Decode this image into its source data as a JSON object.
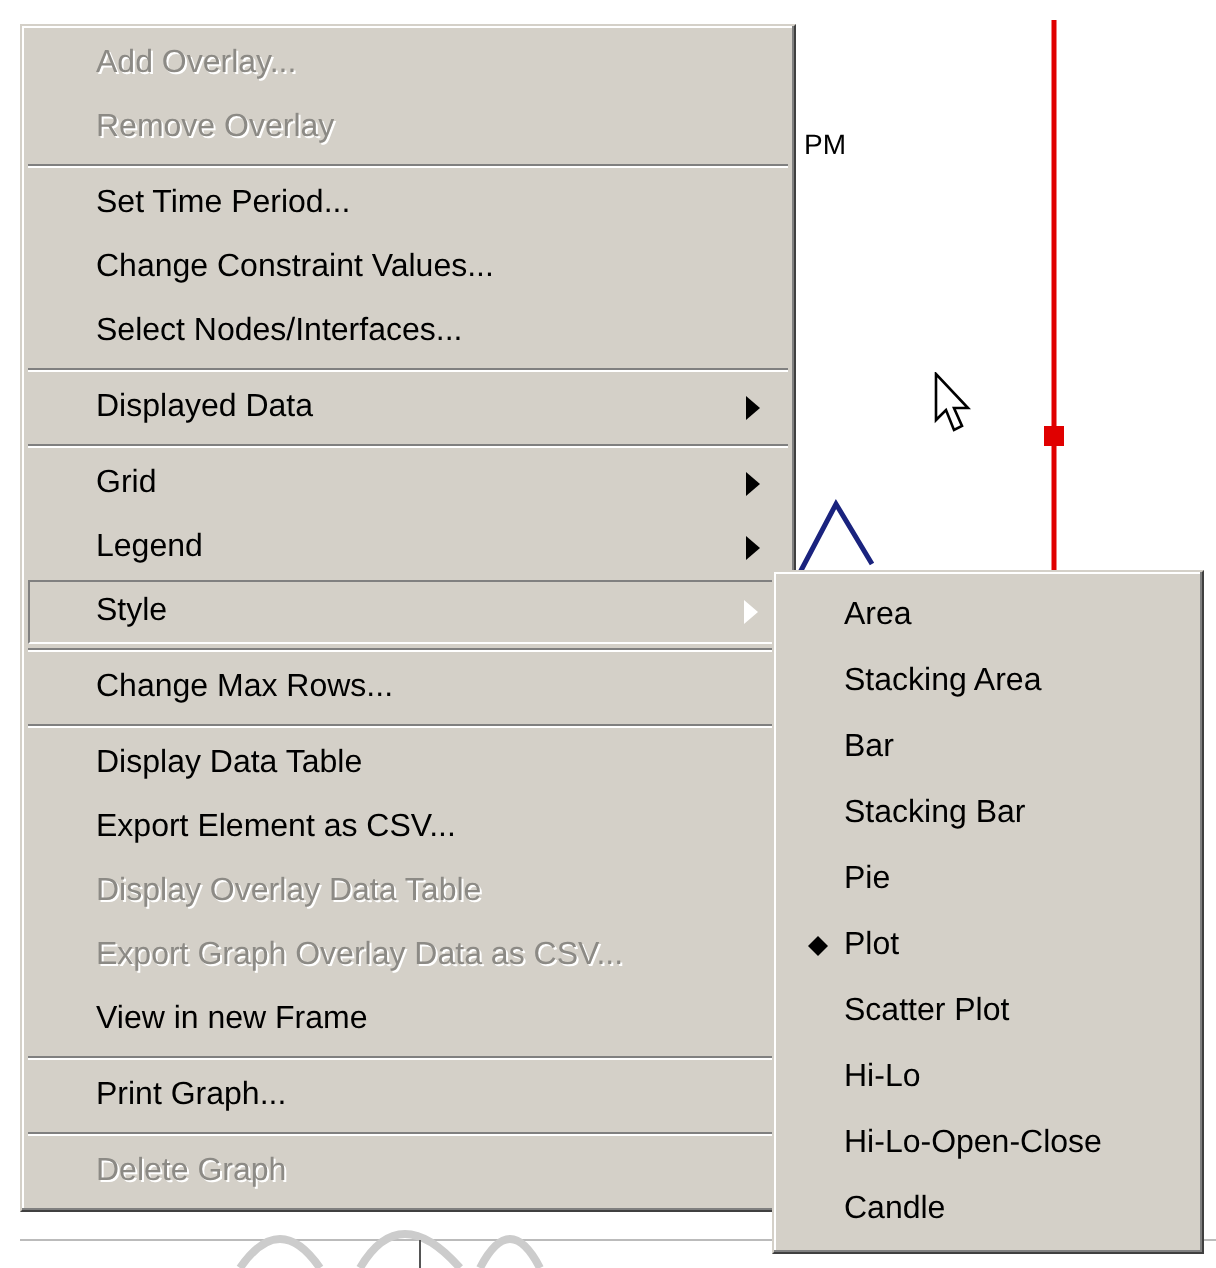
{
  "graph": {
    "time_label": "PM"
  },
  "menu": {
    "items": [
      {
        "kind": "item",
        "label": "Add Overlay...",
        "disabled": true,
        "submenu": false,
        "selected": false
      },
      {
        "kind": "item",
        "label": "Remove Overlay",
        "disabled": true,
        "submenu": false,
        "selected": false
      },
      {
        "kind": "separator"
      },
      {
        "kind": "item",
        "label": "Set Time Period...",
        "disabled": false,
        "submenu": false,
        "selected": false
      },
      {
        "kind": "item",
        "label": "Change Constraint Values...",
        "disabled": false,
        "submenu": false,
        "selected": false
      },
      {
        "kind": "item",
        "label": "Select Nodes/Interfaces...",
        "disabled": false,
        "submenu": false,
        "selected": false
      },
      {
        "kind": "separator"
      },
      {
        "kind": "item",
        "label": "Displayed Data",
        "disabled": false,
        "submenu": true,
        "selected": false
      },
      {
        "kind": "separator"
      },
      {
        "kind": "item",
        "label": "Grid",
        "disabled": false,
        "submenu": true,
        "selected": false
      },
      {
        "kind": "item",
        "label": "Legend",
        "disabled": false,
        "submenu": true,
        "selected": false
      },
      {
        "kind": "item",
        "label": "Style",
        "disabled": false,
        "submenu": true,
        "selected": true
      },
      {
        "kind": "separator"
      },
      {
        "kind": "item",
        "label": "Change Max Rows...",
        "disabled": false,
        "submenu": false,
        "selected": false
      },
      {
        "kind": "separator"
      },
      {
        "kind": "item",
        "label": "Display Data Table",
        "disabled": false,
        "submenu": false,
        "selected": false
      },
      {
        "kind": "item",
        "label": "Export Element as CSV...",
        "disabled": false,
        "submenu": false,
        "selected": false
      },
      {
        "kind": "item",
        "label": "Display Overlay Data Table",
        "disabled": true,
        "submenu": false,
        "selected": false
      },
      {
        "kind": "item",
        "label": "Export Graph Overlay Data as CSV...",
        "disabled": true,
        "submenu": false,
        "selected": false
      },
      {
        "kind": "item",
        "label": "View in new Frame",
        "disabled": false,
        "submenu": false,
        "selected": false
      },
      {
        "kind": "separator"
      },
      {
        "kind": "item",
        "label": "Print Graph...",
        "disabled": false,
        "submenu": false,
        "selected": false
      },
      {
        "kind": "separator"
      },
      {
        "kind": "item",
        "label": "Delete Graph",
        "disabled": true,
        "submenu": false,
        "selected": false
      }
    ]
  },
  "style_submenu": {
    "items": [
      {
        "label": "Area",
        "checked": false
      },
      {
        "label": "Stacking Area",
        "checked": false
      },
      {
        "label": "Bar",
        "checked": false
      },
      {
        "label": "Stacking Bar",
        "checked": false
      },
      {
        "label": "Pie",
        "checked": false
      },
      {
        "label": "Plot",
        "checked": true
      },
      {
        "label": "Scatter Plot",
        "checked": false
      },
      {
        "label": "Hi-Lo",
        "checked": false
      },
      {
        "label": "Hi-Lo-Open-Close",
        "checked": false
      },
      {
        "label": "Candle",
        "checked": false
      }
    ]
  }
}
